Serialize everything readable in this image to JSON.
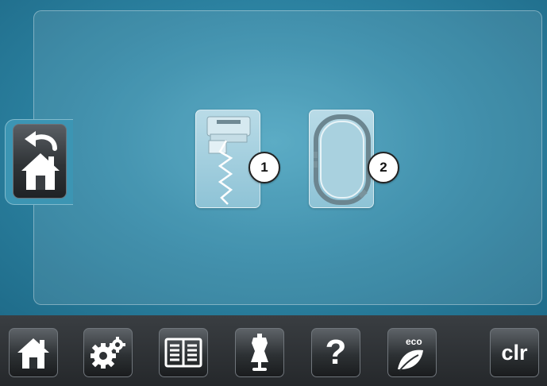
{
  "screen": {
    "accent_color": "#2f87a6",
    "back_home": {
      "icon_top": "back-arrow-icon",
      "icon_bottom": "home-icon"
    }
  },
  "mode_tiles": [
    {
      "name": "sewing",
      "icon": "presser-foot-zigzag-icon",
      "badge": "1"
    },
    {
      "name": "embroidery",
      "icon": "embroidery-hoop-icon",
      "badge": "2"
    }
  ],
  "toolbar": {
    "buttons": [
      {
        "icon": "home-icon"
      },
      {
        "icon": "gears-icon"
      },
      {
        "icon": "book-icon"
      },
      {
        "icon": "dress-form-icon"
      },
      {
        "icon": "question-mark-icon",
        "label": "?"
      },
      {
        "icon": "eco-leaf-icon",
        "label": "eco"
      },
      {
        "icon": "clear-icon",
        "label": "clr"
      }
    ]
  }
}
